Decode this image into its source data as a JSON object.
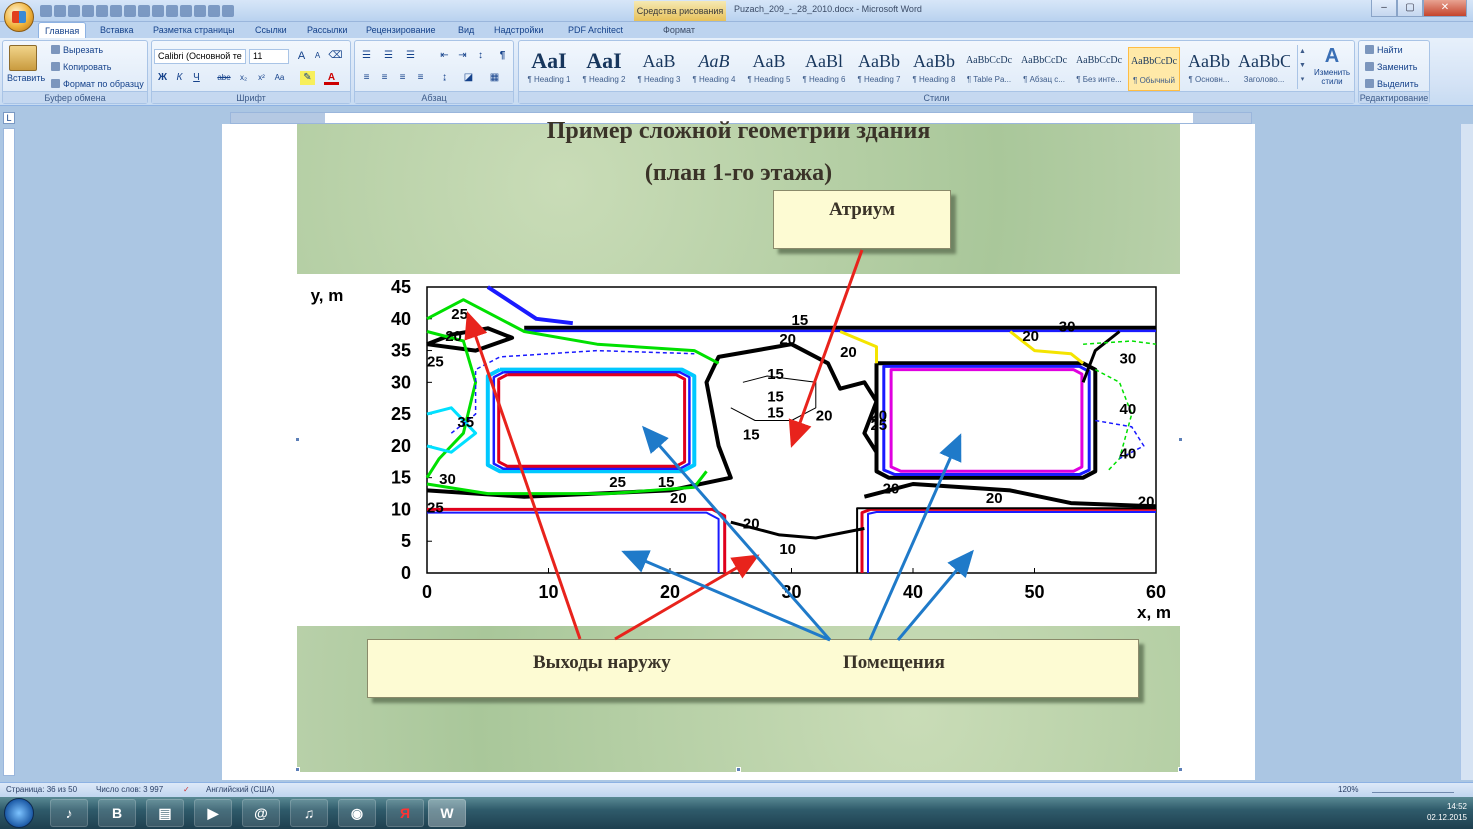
{
  "titlebar": {
    "context_tab": "Средства рисования",
    "doc_title": "Puzach_209_-_28_2010.docx - Microsoft Word",
    "min": "–",
    "max": "▢",
    "close": "✕"
  },
  "tabs": [
    {
      "label": "Главная",
      "active": true
    },
    {
      "label": "Вставка"
    },
    {
      "label": "Разметка страницы"
    },
    {
      "label": "Ссылки"
    },
    {
      "label": "Рассылки"
    },
    {
      "label": "Рецензирование"
    },
    {
      "label": "Вид"
    },
    {
      "label": "Надстройки"
    },
    {
      "label": "PDF Architect"
    },
    {
      "label": "Формат"
    }
  ],
  "clipboard": {
    "paste": "Вставить",
    "cut": "Вырезать",
    "copy": "Копировать",
    "format_painter": "Формат по образцу",
    "label": "Буфер обмена"
  },
  "font": {
    "name": "Calibri (Основной те",
    "size": "11",
    "label": "Шрифт",
    "bold": "Ж",
    "italic": "К",
    "underline": "Ч",
    "strike": "abe",
    "sub": "x₂",
    "sup": "x²",
    "case": "Aa",
    "grow": "A",
    "shrink": "A"
  },
  "paragraph": {
    "label": "Абзац"
  },
  "styles": {
    "label": "Стили",
    "change": "Изменить стили",
    "items": [
      {
        "sample": "AaI",
        "name": "¶ Heading 1"
      },
      {
        "sample": "AaI",
        "name": "¶ Heading 2"
      },
      {
        "sample": "AaB",
        "name": "¶ Heading 3"
      },
      {
        "sample": "AaB",
        "name": "¶ Heading 4"
      },
      {
        "sample": "AaB",
        "name": "¶ Heading 5"
      },
      {
        "sample": "AaBl",
        "name": "¶ Heading 6"
      },
      {
        "sample": "AaBb",
        "name": "¶ Heading 7"
      },
      {
        "sample": "AaBb",
        "name": "¶ Heading 8"
      },
      {
        "sample": "AaBbCcDc",
        "name": "¶ Table Pa..."
      },
      {
        "sample": "AaBbCcDc",
        "name": "¶ Абзац с..."
      },
      {
        "sample": "AaBbCcDc",
        "name": "¶ Без инте..."
      },
      {
        "sample": "AaBbCcDc",
        "name": "¶ Обычный",
        "selected": true
      },
      {
        "sample": "AaBb",
        "name": "¶ Основн..."
      },
      {
        "sample": "AaBbC",
        "name": "Заголово..."
      }
    ]
  },
  "editing": {
    "find": "Найти",
    "replace": "Заменить",
    "select": "Выделить",
    "label": "Редактирование"
  },
  "slide": {
    "title_line1": "Пример сложной геометрии здания",
    "title_line2": "(план 1-го этажа)",
    "atrium": "Атриум",
    "exits": "Выходы   наружу",
    "rooms": "Помещения"
  },
  "chart_data": {
    "type": "contour",
    "xlabel": "x, m",
    "ylabel": "y, m",
    "xlim": [
      0,
      60
    ],
    "ylim": [
      0,
      45
    ],
    "xticks": [
      0,
      10,
      20,
      30,
      40,
      50,
      60
    ],
    "yticks": [
      0,
      5,
      10,
      15,
      20,
      25,
      30,
      35,
      40,
      45
    ],
    "contour_labels": [
      "25",
      "20",
      "25",
      "35",
      "30",
      "25",
      "15",
      "15",
      "15",
      "15",
      "15",
      "20",
      "20",
      "20",
      "15",
      "20",
      "20",
      "30",
      "40",
      "40",
      "20",
      "30",
      "20",
      "20",
      "25",
      "10",
      "20",
      "25",
      "20"
    ]
  },
  "status": {
    "page": "Страница: 36 из 50",
    "words": "Число слов: 3 997",
    "lang": "Английский (США)",
    "zoom": "120%"
  },
  "taskbar": {
    "apps": [
      "В",
      "@",
      "Я",
      "W"
    ],
    "time": "14:52",
    "date": "02.12.2015"
  }
}
